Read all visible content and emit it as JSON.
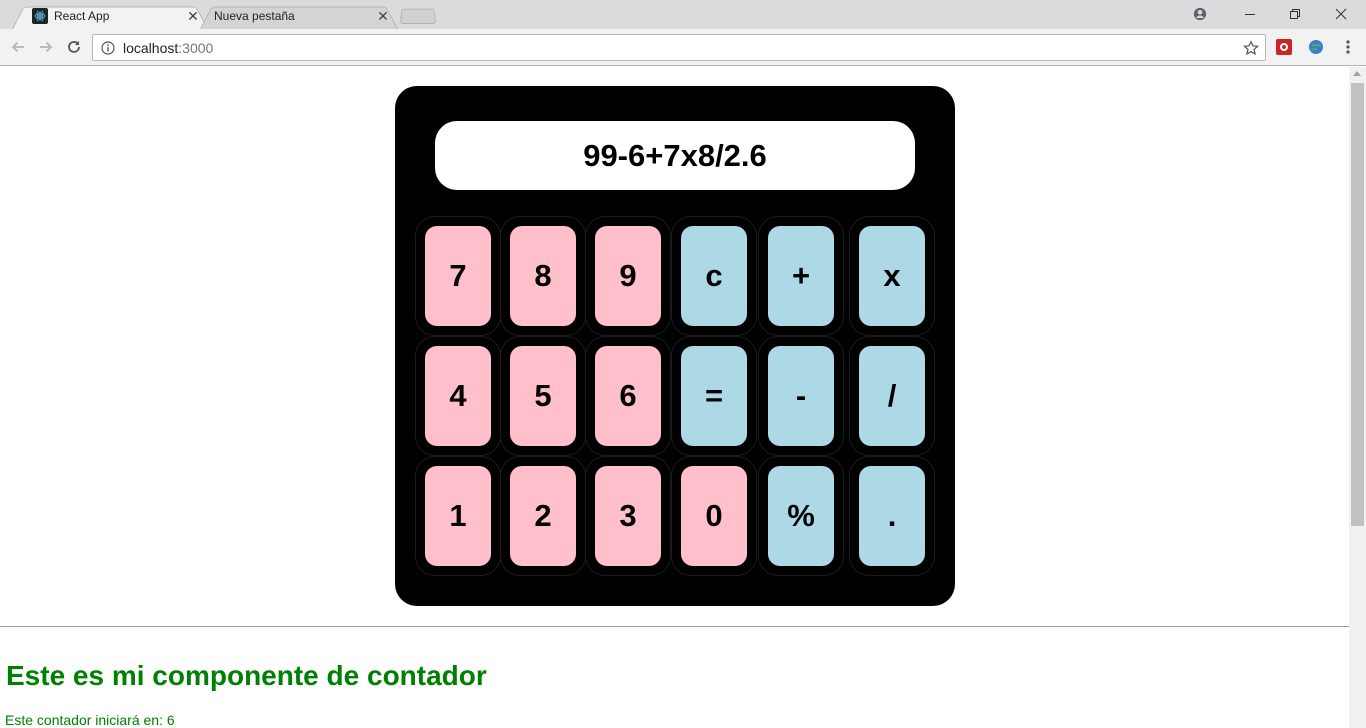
{
  "browser": {
    "tabs": [
      {
        "title": "React App",
        "active": true
      },
      {
        "title": "Nueva pestaña",
        "active": false
      }
    ],
    "url": {
      "host": "localhost",
      "port": ":3000"
    }
  },
  "calculator": {
    "display": "99-6+7x8/2.6",
    "rows": [
      [
        "7",
        "8",
        "9",
        "c",
        "+",
        "x"
      ],
      [
        "4",
        "5",
        "6",
        "=",
        "-",
        "/"
      ],
      [
        "1",
        "2",
        "3",
        "0",
        "%",
        "."
      ]
    ],
    "colors": {
      "number_key": "#ffc0cb",
      "operator_key": "#add8e6",
      "body": "#000000"
    }
  },
  "counter": {
    "title": "Este es mi componente de contador",
    "text": "Este contador iniciará en: 6",
    "color": "#008000"
  }
}
